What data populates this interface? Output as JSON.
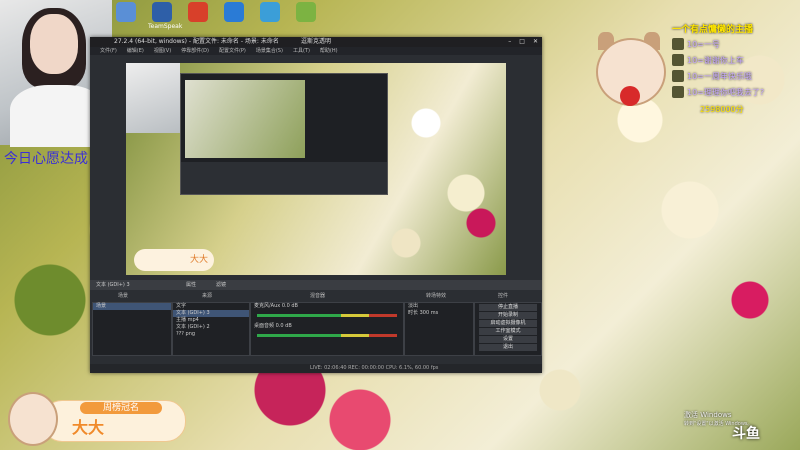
{
  "desktop_icons": [
    "",
    "TeamSpeak",
    "",
    "",
    "",
    "",
    ""
  ],
  "overlay": {
    "streamer_caption": "今日心愿达成",
    "top_title": "一个有点慵懒的主播",
    "viewers": "2598000分"
  },
  "chat": [
    {
      "text": "10=一号"
    },
    {
      "text": "10=谢谢你上车"
    },
    {
      "text": "10=一周年快乐哦"
    },
    {
      "text": "10=理理你吧我去了?"
    }
  ],
  "obs": {
    "title": "逗斯克透明",
    "version": "27.2.4 (64-bit, windows) - 配置文件: 未命名 - 场景: 未命名",
    "menu": [
      "文件(F)",
      "编辑(E)",
      "视图(V)",
      "停靠部件(D)",
      "配置文件(P)",
      "场景集合(S)",
      "工具(T)",
      "帮助(H)"
    ],
    "source_bar": {
      "label": "文本 (GDI+) 3",
      "properties": "属性",
      "filters": "滤镜"
    },
    "dock_tabs": [
      "场景",
      "来源",
      "混音器",
      "转场特效",
      "控件"
    ],
    "scenes": [
      "场景"
    ],
    "sources": [
      "文字",
      "文本 (GDI+) 3",
      "主播 mp4",
      "文本 (GDI+) 2",
      "??? png"
    ],
    "mixer": [
      {
        "name": "麦克风/Aux",
        "db": "0.0 dB"
      },
      {
        "name": "桌面音频",
        "db": "0.0 dB"
      }
    ],
    "transition": {
      "type": "淡出",
      "duration_label": "时长",
      "duration": "300 ms"
    },
    "controls": [
      "停止直播",
      "开始录制",
      "启动虚拟摄像机",
      "工作室模式",
      "设置",
      "退出"
    ],
    "status": "LIVE: 02:06:40  REC: 00:00:00  CPU: 6.1%, 60.00 fps"
  },
  "badge": {
    "label": "周榜冠名",
    "name": "大大"
  },
  "windows_watermark": {
    "line1": "激活 Windows",
    "line2": "转到\"设置\"以激活 Windows。"
  },
  "logo": "斗鱼"
}
